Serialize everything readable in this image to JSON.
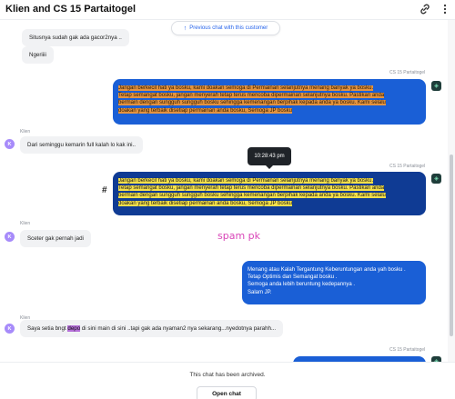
{
  "header": {
    "title": "Klien and CS 15 Partaitogel",
    "link_icon": "link-icon",
    "more_icon": "more-vertical-icon"
  },
  "previous_chat": {
    "label": "Previous chat with this customer",
    "icon": "arrow-up-icon"
  },
  "messages": {
    "m1": {
      "text": "Situsnya sudah gak ada gacor2nya .."
    },
    "m2": {
      "text": "Ngeriiii"
    },
    "m3": {
      "sender": "CS 15 Partaitogel",
      "lines": [
        "Jangan berkecil hati ya bosku, kami doakan semoga di Permainan selanjutnya menang banyak ya bosku.",
        "Tetap semangat bosku, jangan menyerah tetap terus mencoba dipermainan selanjutnya bosku. Pastikan anda",
        "bermain dengan sungguh sungguh bosku sehingga kemenangan berpihak kepada anda ya bosku. Kami selalu",
        "doakan yang terbaik disetiap permainan anda bosku, Semoga JP bosku"
      ]
    },
    "m4": {
      "sender": "Klien",
      "avatar": "K",
      "text": "Dari seminggu kemarin full kalah lo kak ini.."
    },
    "m5": {
      "sender": "CS 15 Partaitogel",
      "tooltip": "10:28:43 pm",
      "hash": "#",
      "lines": [
        "Jangan berkecil hati ya bosku, kami doakan semoga di Permainan selanjutnya menang banyak ya bosku.",
        "Tetap semangat bosku, jangan menyerah tetap terus mencoba dipermainan selanjutnya bosku. Pastikan anda",
        "bermain dengan sungguh sungguh bosku sehingga kemenangan berpihak kepada anda ya bosku. Kami selalu",
        "doakan yang terbaik disetiap permainan anda bosku, Semoga JP bosku"
      ]
    },
    "m6": {
      "sender": "Klien",
      "avatar": "K",
      "text": "Sceter gak pernah jadi"
    },
    "annotation": "spam pk",
    "m7": {
      "sender": "CS 15 Partaitogel",
      "lines": [
        "Menang atau Kalah Tergantung Keberuntungan anda yah bosku .",
        "Tetap Optimis dan Semangat bosku .",
        "Semoga anda lebih beruntung kedepannya .",
        "Salam JP."
      ]
    },
    "m8": {
      "sender": "Klien",
      "avatar": "K",
      "text_before": "Saya setia bngt ",
      "text_highlight": "depo",
      "text_after": " di sini main di sini ..tapi gak ada nyaman2 nya sekarang...nyedotnya parahh..."
    },
    "m9": {
      "sender": "CS 15 Partaitogel"
    }
  },
  "footer": {
    "archived_text": "This chat has been archived.",
    "open_chat_label": "Open chat"
  },
  "colors": {
    "agent_bubble": "#1a5fd6",
    "agent_bubble_selected": "#0f3b94",
    "highlight_orange": "#e4933f",
    "highlight_yellow": "#f4e04a",
    "highlight_purple": "#b56fd8",
    "client_avatar": "#a78bfa",
    "annotation": "#d946b8",
    "link": "#2563eb"
  }
}
